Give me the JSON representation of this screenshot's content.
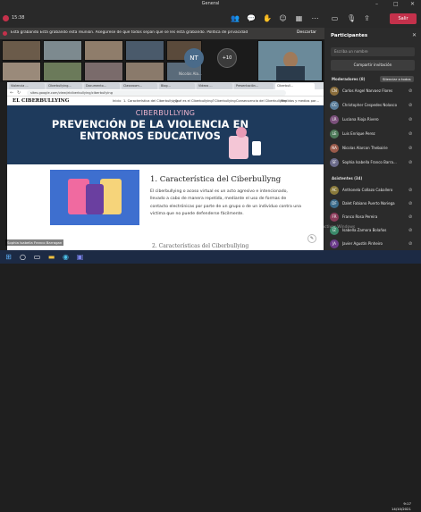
{
  "window": {
    "title": "General"
  },
  "meeting": {
    "timer": "15:38",
    "leave_label": "Salir",
    "icons": [
      "people-icon",
      "chat-icon",
      "raise-hand-icon",
      "reactions-icon",
      "rooms-icon",
      "more-icon",
      "camera-icon",
      "mic-icon",
      "share-icon"
    ]
  },
  "banner": {
    "message": "Está grabando  Está grabando esta reunión. Asegúrese de que todos sepan que se les está grabando. Política de privacidad",
    "dismiss": "Descartar"
  },
  "videos": [
    {
      "label": ""
    },
    {
      "label": ""
    },
    {
      "label": ""
    },
    {
      "label": ""
    },
    {
      "label": ""
    },
    {
      "label": ""
    },
    {
      "label": ""
    },
    {
      "label": ""
    },
    {
      "label": ""
    },
    {
      "label": ""
    },
    {
      "initials": "NT",
      "label": "Nicolás Ala..."
    },
    {
      "initials": "+10",
      "label": ""
    },
    {
      "label": ""
    }
  ],
  "browser": {
    "tabs": [
      "Violencia ...",
      "Ciberbullying...",
      "Documento...",
      "Classroom...",
      "Blog...",
      "Videos ...",
      "Presentación...",
      "Ciberbull..."
    ],
    "address": "sites.google.com/view/elciberbullying/ciberbullying"
  },
  "site": {
    "brand": "EL CIBERBULLYING",
    "nav": [
      "Inicio",
      "1. Característica del Ciberbullying",
      "¿Qué es el Ciberbullying?",
      "Ciberbullying",
      "Consecuencia del Ciberbullying",
      "Medidas y medios para combate..."
    ],
    "hero_kicker": "CIBERBULLYING",
    "hero_heading": "PREVENCIÓN DE LA VIOLENCIA EN ENTORNOS EDUCATIVOS",
    "section_title": "1. Característica del Ciberbullyng",
    "paragraph": "El ciberbullying o acoso virtual es un acto agresivo e intencionado, llevado a cabo de manera repetida, mediante el uso de formas de contacto electrónicas por parte de un grupo o de un individuo contra una víctima que no puede defenderse fácilmente.",
    "next_title": "2. Características del Ciberbullying"
  },
  "participants": {
    "title": "Participantes",
    "search_placeholder": "Escriba un nombre",
    "share_label": "Compartir invitación",
    "presenters_header": "Moderadores (8)",
    "mute_all": "Silenciar a todos",
    "attendees_header": "Asistentes (34)",
    "presenters": [
      {
        "name": "Carlos Angel Narvaez Flores",
        "color": "#8a6d3b",
        "initials": "CN"
      },
      {
        "name": "Christopher Cespedes Nolasco",
        "color": "#5a7d9a",
        "initials": "CC"
      },
      {
        "name": "Luciana Rioja Rivero",
        "color": "#7a4f7a",
        "initials": "LR"
      },
      {
        "name": "Luis Enrique Perez",
        "color": "#4f7a5a",
        "initials": "LE"
      },
      {
        "name": "Nicolas Alarcon Thebairie",
        "color": "#9a5a4a",
        "initials": "NA"
      },
      {
        "name": "Sophia Isabella Franco Barra...",
        "color": "#6b6b8a",
        "initials": "SF"
      }
    ],
    "attendees": [
      {
        "name": "Anthonela Collazo Caballero",
        "color": "#8a7a3b",
        "initials": "AC"
      },
      {
        "name": "Dalet Fabiano Puerto Noriega",
        "color": "#3b6b8a",
        "initials": "DF"
      },
      {
        "name": "Franco Rosa Pereira",
        "color": "#8a3b5a",
        "initials": "FR"
      },
      {
        "name": "Isabella Zamora Bolaños",
        "color": "#3b8a6b",
        "initials": "IZ"
      },
      {
        "name": "Javier Agustín Pinheiro",
        "color": "#6b3b8a",
        "initials": "JA"
      }
    ]
  },
  "caption": "Sophia Isabella Franco Barragan",
  "watermark": [
    "Activar Windows",
    "Ve a Configuración para activar Windows."
  ],
  "clock": {
    "time": "9:17",
    "date": "14/10/2021"
  }
}
